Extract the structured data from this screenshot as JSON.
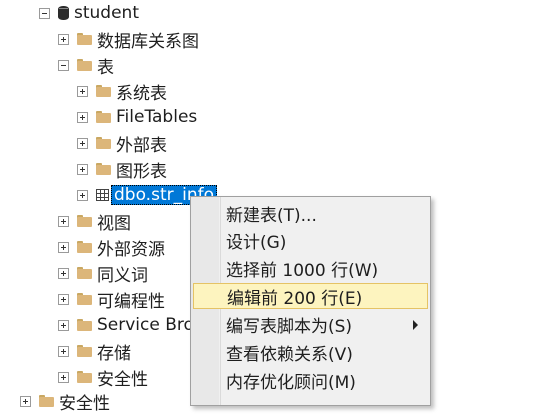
{
  "tree": {
    "database": "student",
    "items": [
      {
        "label": "数据库关系图"
      },
      {
        "label": "表"
      },
      {
        "label": "系统表"
      },
      {
        "label": "FileTables"
      },
      {
        "label": "外部表"
      },
      {
        "label": "图形表"
      },
      {
        "label": "dbo.str_info"
      },
      {
        "label": "视图"
      },
      {
        "label": "外部资源"
      },
      {
        "label": "同义词"
      },
      {
        "label": "可编程性"
      },
      {
        "label": "Service Broker"
      },
      {
        "label": "存储"
      },
      {
        "label": "安全性"
      },
      {
        "label": "安全性"
      }
    ]
  },
  "context_menu": {
    "items": [
      {
        "label": "新建表(T)..."
      },
      {
        "label": "设计(G)"
      },
      {
        "label": "选择前 1000 行(W)"
      },
      {
        "label": "编辑前 200 行(E)"
      },
      {
        "label": "编写表脚本为(S)"
      },
      {
        "label": "查看依赖关系(V)"
      },
      {
        "label": "内存优化顾问(M)"
      }
    ],
    "highlighted_index": 3
  },
  "colors": {
    "selection": "#0078d7",
    "menu_highlight": "#fdf4bf",
    "folder": "#dcb67a"
  }
}
